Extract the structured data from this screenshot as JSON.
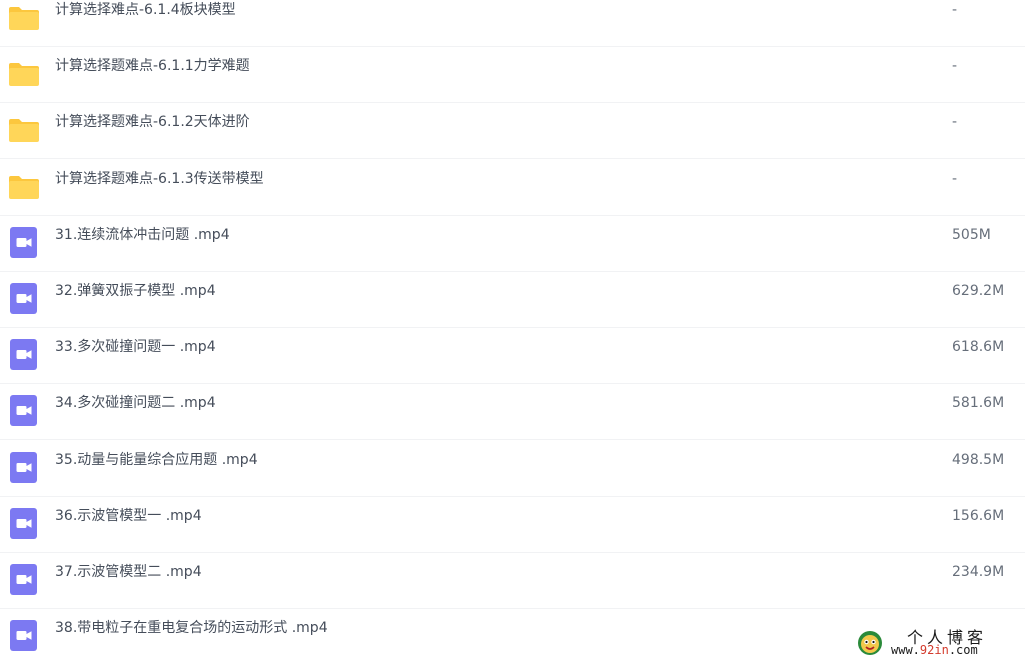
{
  "files": [
    {
      "type": "folder",
      "icon": "folder-icon",
      "name": "计算选择难点-6.1.4板块模型",
      "size": "-"
    },
    {
      "type": "folder",
      "icon": "folder-icon",
      "name": "计算选择题难点-6.1.1力学难题",
      "size": "-"
    },
    {
      "type": "folder",
      "icon": "folder-icon",
      "name": "计算选择题难点-6.1.2天体进阶",
      "size": "-"
    },
    {
      "type": "folder",
      "icon": "folder-icon",
      "name": "计算选择题难点-6.1.3传送带模型",
      "size": "-"
    },
    {
      "type": "video",
      "icon": "video-file-icon",
      "name": "31.连续流体冲击问题 .mp4",
      "size": "505M"
    },
    {
      "type": "video",
      "icon": "video-file-icon",
      "name": "32.弹簧双振子模型 .mp4",
      "size": "629.2M"
    },
    {
      "type": "video",
      "icon": "video-file-icon",
      "name": "33.多次碰撞问题一 .mp4",
      "size": "618.6M"
    },
    {
      "type": "video",
      "icon": "video-file-icon",
      "name": "34.多次碰撞问题二 .mp4",
      "size": "581.6M"
    },
    {
      "type": "video",
      "icon": "video-file-icon",
      "name": "35.动量与能量综合应用题 .mp4",
      "size": "498.5M"
    },
    {
      "type": "video",
      "icon": "video-file-icon",
      "name": "36.示波管模型一 .mp4",
      "size": "156.6M"
    },
    {
      "type": "video",
      "icon": "video-file-icon",
      "name": "37.示波管模型二 .mp4",
      "size": "234.9M"
    },
    {
      "type": "video",
      "icon": "video-file-icon",
      "name": "38.带电粒子在重电复合场的运动形式 .mp4",
      "size": ""
    }
  ],
  "watermark": {
    "title": "个人博客",
    "url_prefix": "www.",
    "url_accent": "92in",
    "url_suffix": ".com"
  },
  "colors": {
    "folder": "#ffd659",
    "folder_tab": "#fcc73e",
    "video": "#7c79f2",
    "divider": "#f1f2f4"
  }
}
